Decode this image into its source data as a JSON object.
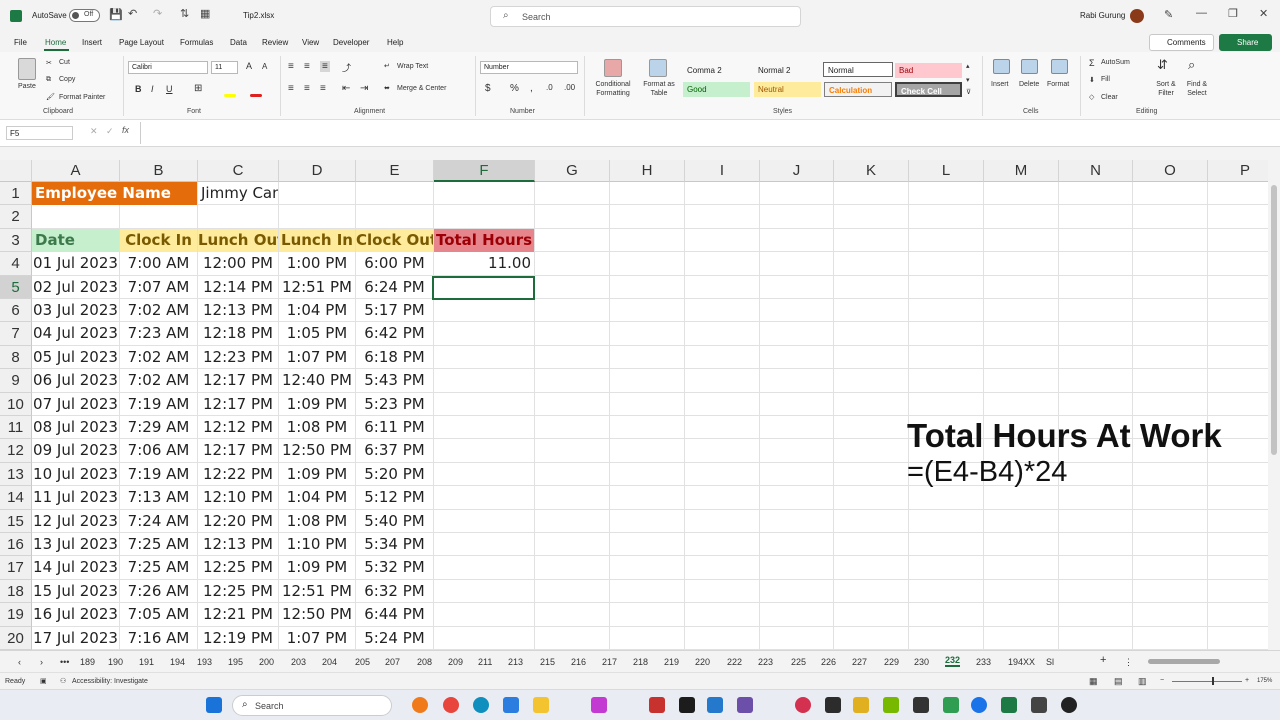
{
  "title": {
    "autosave": "AutoSave",
    "autosave_state": "Off",
    "filename": "Tip2.xlsx",
    "search_placeholder": "Search",
    "user": "Rabi Gurung"
  },
  "menu": [
    "File",
    "Home",
    "Insert",
    "Page Layout",
    "Formulas",
    "Data",
    "Review",
    "View",
    "Developer",
    "Help"
  ],
  "menu_buttons": {
    "comments": "Comments",
    "share": "Share"
  },
  "ribbon": {
    "clipboard": {
      "paste": "Paste",
      "cut": "Cut",
      "copy": "Copy",
      "format_painter": "Format Painter",
      "group": "Clipboard"
    },
    "font": {
      "name": "Calibri",
      "size": "11",
      "group": "Font"
    },
    "alignment": {
      "wrap": "Wrap Text",
      "merge": "Merge & Center",
      "group": "Alignment"
    },
    "number": {
      "format": "Number",
      "group": "Number"
    },
    "styles": {
      "conditional": "Conditional Formatting",
      "format_table": "Format as Table",
      "items": [
        "Comma 2",
        "Normal 2",
        "Normal",
        "Bad",
        "Good",
        "Neutral",
        "Calculation",
        "Check Cell"
      ],
      "group": "Styles"
    },
    "cells": {
      "insert": "Insert",
      "delete": "Delete",
      "format": "Format",
      "group": "Cells"
    },
    "editing": {
      "autosum": "AutoSum",
      "fill": "Fill",
      "clear": "Clear",
      "sort": "Sort & Filter",
      "find": "Find & Select",
      "group": "Editing"
    }
  },
  "formula_bar": {
    "name_box": "F5",
    "formula": ""
  },
  "columns": [
    "A",
    "B",
    "C",
    "D",
    "E",
    "F",
    "G",
    "H",
    "I",
    "J",
    "K",
    "L",
    "M",
    "N",
    "O",
    "P"
  ],
  "sheet": {
    "employee_label": "Employee Name",
    "employee_name": "Jimmy Candle",
    "headers": [
      "Date",
      "Clock In",
      "Lunch Out",
      "Lunch In",
      "Clock Out",
      "Total Hours"
    ],
    "rows": [
      [
        "01 Jul 2023",
        "7:00 AM",
        "12:00 PM",
        "1:00 PM",
        "6:00 PM",
        "11.00"
      ],
      [
        "02 Jul 2023",
        "7:07 AM",
        "12:14 PM",
        "12:51 PM",
        "6:24 PM",
        ""
      ],
      [
        "03 Jul 2023",
        "7:02 AM",
        "12:13 PM",
        "1:04 PM",
        "5:17 PM",
        ""
      ],
      [
        "04 Jul 2023",
        "7:23 AM",
        "12:18 PM",
        "1:05 PM",
        "6:42 PM",
        ""
      ],
      [
        "05 Jul 2023",
        "7:02 AM",
        "12:23 PM",
        "1:07 PM",
        "6:18 PM",
        ""
      ],
      [
        "06 Jul 2023",
        "7:02 AM",
        "12:17 PM",
        "12:40 PM",
        "5:43 PM",
        ""
      ],
      [
        "07 Jul 2023",
        "7:19 AM",
        "12:17 PM",
        "1:09 PM",
        "5:23 PM",
        ""
      ],
      [
        "08 Jul 2023",
        "7:29 AM",
        "12:12 PM",
        "1:08 PM",
        "6:11 PM",
        ""
      ],
      [
        "09 Jul 2023",
        "7:06 AM",
        "12:17 PM",
        "12:50 PM",
        "6:37 PM",
        ""
      ],
      [
        "10 Jul 2023",
        "7:19 AM",
        "12:22 PM",
        "1:09 PM",
        "5:20 PM",
        ""
      ],
      [
        "11 Jul 2023",
        "7:13 AM",
        "12:10 PM",
        "1:04 PM",
        "5:12 PM",
        ""
      ],
      [
        "12 Jul 2023",
        "7:24 AM",
        "12:20 PM",
        "1:08 PM",
        "5:40 PM",
        ""
      ],
      [
        "13 Jul 2023",
        "7:25 AM",
        "12:13 PM",
        "1:10 PM",
        "5:34 PM",
        ""
      ],
      [
        "14 Jul 2023",
        "7:25 AM",
        "12:25 PM",
        "1:09 PM",
        "5:32 PM",
        ""
      ],
      [
        "15 Jul 2023",
        "7:26 AM",
        "12:25 PM",
        "12:51 PM",
        "6:32 PM",
        ""
      ],
      [
        "16 Jul 2023",
        "7:05 AM",
        "12:21 PM",
        "12:50 PM",
        "6:44 PM",
        ""
      ],
      [
        "17 Jul 2023",
        "7:16 AM",
        "12:19 PM",
        "1:07 PM",
        "5:24 PM",
        ""
      ]
    ],
    "colors": {
      "orange": "#e46c0a",
      "green": "#c6efce",
      "yellow": "#ffeb9c",
      "red": "#e6858c"
    }
  },
  "overlay": {
    "title": "Total Hours At Work",
    "formula": "=(E4-B4)*24"
  },
  "sheet_tabs": [
    "189",
    "190",
    "191",
    "194",
    "193",
    "195",
    "200",
    "203",
    "204",
    "205",
    "207",
    "208",
    "209",
    "211",
    "213",
    "215",
    "216",
    "217",
    "218",
    "219",
    "220",
    "222",
    "223",
    "225",
    "226",
    "227",
    "229",
    "230",
    "232",
    "233",
    "194XX",
    "Sl"
  ],
  "active_tab": "232",
  "status": {
    "ready": "Ready",
    "accessibility": "Accessibility: Investigate",
    "zoom": "175%"
  },
  "taskbar": {
    "search": "Search"
  }
}
